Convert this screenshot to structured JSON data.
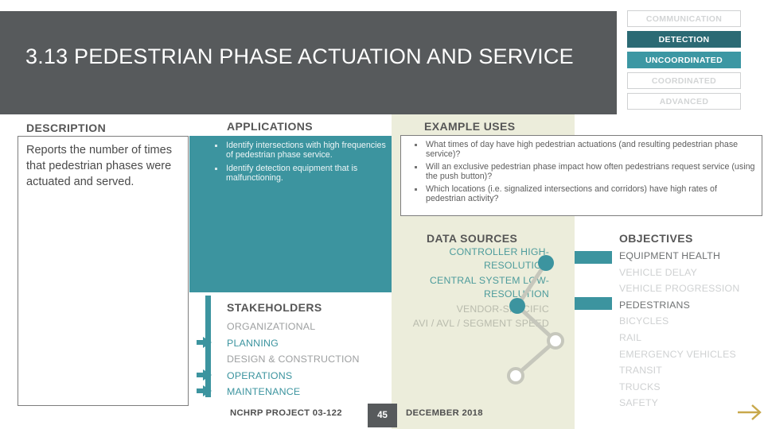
{
  "header": {
    "title": "3.13 PEDESTRIAN PHASE ACTUATION AND SERVICE",
    "background": "#575a5c"
  },
  "tags": [
    {
      "label": "COMMUNICATION",
      "state": "off"
    },
    {
      "label": "DETECTION",
      "state": "dark"
    },
    {
      "label": "UNCOORDINATED",
      "state": "mid"
    },
    {
      "label": "COORDINATED",
      "state": "off"
    },
    {
      "label": "ADVANCED",
      "state": "off"
    }
  ],
  "sections": {
    "description_heading": "DESCRIPTION",
    "applications_heading": "APPLICATIONS",
    "example_uses_heading": "EXAMPLE USES",
    "data_sources_heading": "DATA SOURCES",
    "objectives_heading": "OBJECTIVES",
    "stakeholders_heading": "STAKEHOLDERS"
  },
  "description": {
    "text": "Reports the number of times that pedestrian phases were actuated and served."
  },
  "applications": {
    "items": [
      "Identify intersections with high frequencies of pedestrian phase service.",
      "Identify detection equipment that is malfunctioning."
    ]
  },
  "example_uses": {
    "items": [
      "What times of day have high pedestrian actuations (and resulting pedestrian phase service)?",
      "Will an exclusive pedestrian phase impact how often pedestrians request service (using the push button)?",
      "Which locations (i.e. signalized intersections and corridors) have high rates of pedestrian activity?"
    ]
  },
  "stakeholders": {
    "items": [
      {
        "label": "ORGANIZATIONAL",
        "active": false
      },
      {
        "label": "PLANNING",
        "active": true
      },
      {
        "label": "DESIGN & CONSTRUCTION",
        "active": false
      },
      {
        "label": "OPERATIONS",
        "active": true
      },
      {
        "label": "MAINTENANCE",
        "active": true
      }
    ]
  },
  "data_sources": {
    "items": [
      {
        "label": "CONTROLLER HIGH-RESOLUTION",
        "active": true
      },
      {
        "label": "CENTRAL SYSTEM LOW-RESOLUTION",
        "active": true
      },
      {
        "label": "VENDOR-SPECIFIC",
        "active": false
      },
      {
        "label": "AVI / AVL / SEGMENT SPEED",
        "active": false
      }
    ]
  },
  "objectives": {
    "items": [
      {
        "label": "EQUIPMENT HEALTH",
        "active": true
      },
      {
        "label": "VEHICLE DELAY",
        "active": false
      },
      {
        "label": "VEHICLE PROGRESSION",
        "active": false
      },
      {
        "label": "PEDESTRIANS",
        "active": true
      },
      {
        "label": "BICYCLES",
        "active": false
      },
      {
        "label": "RAIL",
        "active": false
      },
      {
        "label": "EMERGENCY VEHICLES",
        "active": false
      },
      {
        "label": "TRANSIT",
        "active": false
      },
      {
        "label": "TRUCKS",
        "active": false
      },
      {
        "label": "SAFETY",
        "active": false
      }
    ]
  },
  "footer": {
    "project": "NCHRP PROJECT 03-122",
    "page": "45",
    "date": "DECEMBER 2018"
  },
  "colors": {
    "teal": "#3c949f",
    "teal_dark": "#2b6a74",
    "header_gray": "#575a5c",
    "panel_green": "#eceddb",
    "inactive_gray": "#cfd1d2",
    "arrow_gold": "#c8a84b"
  }
}
